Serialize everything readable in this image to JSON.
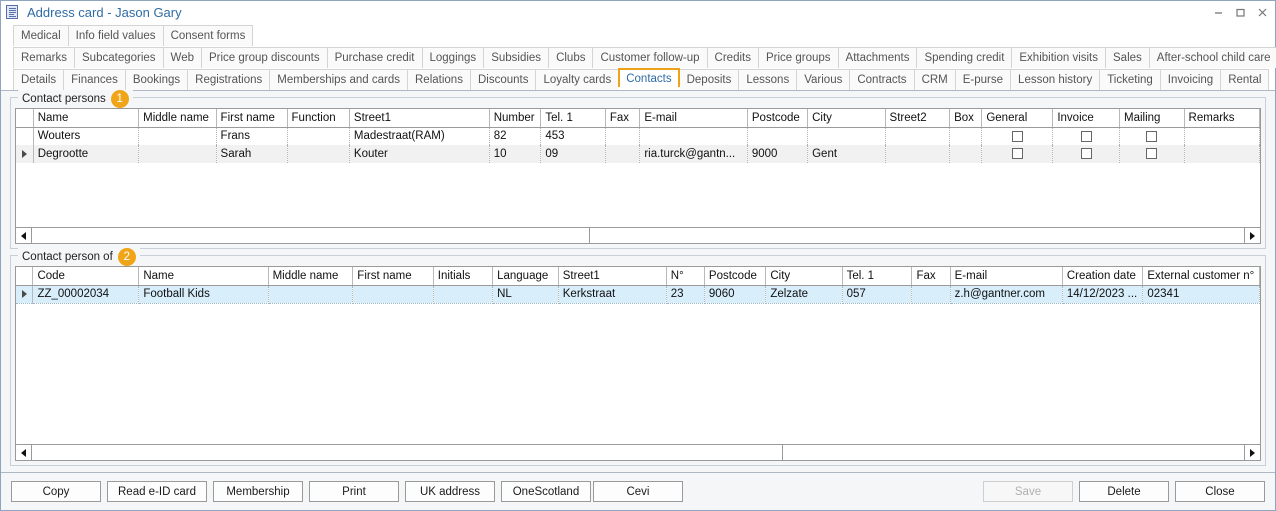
{
  "window": {
    "title": "Address card - Jason Gary",
    "icon": "address-card-icon",
    "minimize_label": "–",
    "maximize_label": "□",
    "close_label": "✕",
    "accent_color": "#eda218",
    "title_color": "#2f6ca5"
  },
  "tabs": {
    "row1": [
      {
        "label": "Medical",
        "active": false
      },
      {
        "label": "Info field values",
        "active": false
      },
      {
        "label": "Consent forms",
        "active": false
      }
    ],
    "row2": [
      {
        "label": "Remarks",
        "active": false
      },
      {
        "label": "Subcategories",
        "active": false
      },
      {
        "label": "Web",
        "active": false
      },
      {
        "label": "Price group discounts",
        "active": false
      },
      {
        "label": "Purchase credit",
        "active": false
      },
      {
        "label": "Loggings",
        "active": false
      },
      {
        "label": "Subsidies",
        "active": false
      },
      {
        "label": "Clubs",
        "active": false
      },
      {
        "label": "Customer follow-up",
        "active": false
      },
      {
        "label": "Credits",
        "active": false
      },
      {
        "label": "Price groups",
        "active": false
      },
      {
        "label": "Attachments",
        "active": false
      },
      {
        "label": "Spending credit",
        "active": false
      },
      {
        "label": "Exhibition visits",
        "active": false
      },
      {
        "label": "Sales",
        "active": false
      },
      {
        "label": "After-school child care",
        "active": false
      }
    ],
    "row3": [
      {
        "label": "Details",
        "active": false
      },
      {
        "label": "Finances",
        "active": false
      },
      {
        "label": "Bookings",
        "active": false
      },
      {
        "label": "Registrations",
        "active": false
      },
      {
        "label": "Memberships and cards",
        "active": false
      },
      {
        "label": "Relations",
        "active": false
      },
      {
        "label": "Discounts",
        "active": false
      },
      {
        "label": "Loyalty cards",
        "active": false
      },
      {
        "label": "Contacts",
        "active": true
      },
      {
        "label": "Deposits",
        "active": false
      },
      {
        "label": "Lessons",
        "active": false
      },
      {
        "label": "Various",
        "active": false
      },
      {
        "label": "Contracts",
        "active": false
      },
      {
        "label": "CRM",
        "active": false
      },
      {
        "label": "E-purse",
        "active": false
      },
      {
        "label": "Lesson history",
        "active": false
      },
      {
        "label": "Ticketing",
        "active": false
      },
      {
        "label": "Invoicing",
        "active": false
      },
      {
        "label": "Rental",
        "active": false
      }
    ]
  },
  "contact_persons": {
    "legend": "Contact persons",
    "badge": "1",
    "columns": [
      "Name",
      "Middle name",
      "First name",
      "Function",
      "Street1",
      "Number",
      "Tel. 1",
      "Fax",
      "E-mail",
      "Postcode",
      "City",
      "Street2",
      "Box",
      "General",
      "Invoice",
      "Mailing",
      "Remarks"
    ],
    "rows": [
      {
        "selected": false,
        "marker": false,
        "cells": {
          "Name": "Wouters",
          "Middle name": "",
          "First name": "Frans",
          "Function": "",
          "Street1": "Madestraat(RAM)",
          "Number": "82",
          "Tel. 1": "453",
          "Fax": "",
          "E-mail": "",
          "Postcode": "",
          "City": "",
          "Street2": "",
          "Box": "",
          "General": false,
          "Invoice": false,
          "Mailing": false,
          "Remarks": ""
        }
      },
      {
        "selected": false,
        "marker": true,
        "cells": {
          "Name": "Degrootte",
          "Middle name": "",
          "First name": "Sarah",
          "Function": "",
          "Street1": "Kouter",
          "Number": "10",
          "Tel. 1": "09",
          "Fax": "",
          "E-mail": "ria.turck@gantn...",
          "Postcode": "9000",
          "City": "Gent",
          "Street2": "",
          "Box": "",
          "General": false,
          "Invoice": false,
          "Mailing": false,
          "Remarks": ""
        }
      }
    ],
    "scrollbar": {
      "left_arrow": "◀",
      "right_arrow": "▶",
      "thumb_percent": 46
    }
  },
  "contact_person_of": {
    "legend": "Contact person of",
    "badge": "2",
    "columns": [
      "Code",
      "Name",
      "Middle name",
      "First name",
      "Initials",
      "Language",
      "Street1",
      "N°",
      "Postcode",
      "City",
      "Tel. 1",
      "Fax",
      "E-mail",
      "Creation date",
      "External customer n°"
    ],
    "rows": [
      {
        "selected": true,
        "marker": true,
        "cells": {
          "Code": "ZZ_00002034",
          "Name": "Football Kids",
          "Middle name": "",
          "First name": "",
          "Initials": "",
          "Language": "NL",
          "Street1": "Kerkstraat",
          "N°": "23",
          "Postcode": "9060",
          "City": "Zelzate",
          "Tel. 1": "057",
          "Fax": "",
          "E-mail": "z.h@gantner.com",
          "Creation date": "14/12/2023 ...",
          "External customer n°": "02341"
        }
      }
    ],
    "scrollbar": {
      "left_arrow": "◀",
      "right_arrow": "▶",
      "thumb_percent": 62
    }
  },
  "footer": {
    "left_buttons": [
      {
        "label": "Copy",
        "disabled": false
      },
      {
        "label": "Read e-ID card",
        "disabled": false
      },
      {
        "label": "Membership",
        "disabled": false
      },
      {
        "label": "Print",
        "disabled": false
      },
      {
        "label": "UK address",
        "disabled": false
      },
      {
        "label": "OneScotland",
        "disabled": false
      }
    ],
    "center_buttons": [
      {
        "label": "Cevi",
        "disabled": false
      }
    ],
    "right_buttons": [
      {
        "label": "Save",
        "disabled": true
      },
      {
        "label": "Delete",
        "disabled": false
      },
      {
        "label": "Close",
        "disabled": false
      }
    ]
  }
}
